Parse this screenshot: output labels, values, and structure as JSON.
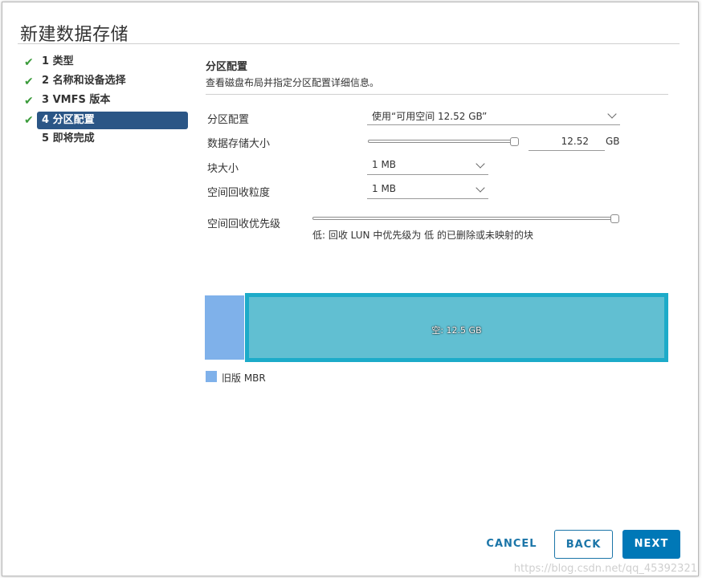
{
  "dialog": {
    "title": "新建数据存储"
  },
  "steps": [
    {
      "number": "1",
      "label": "类型",
      "done": true
    },
    {
      "number": "2",
      "label": "名称和设备选择",
      "done": true
    },
    {
      "number": "3",
      "label": "VMFS 版本",
      "done": true
    },
    {
      "number": "4",
      "label": "分区配置",
      "done": true,
      "active": true
    },
    {
      "number": "5",
      "label": "即将完成",
      "done": false
    }
  ],
  "section": {
    "title": "分区配置",
    "description": "查看磁盘布局并指定分区配置详细信息。"
  },
  "form": {
    "partition_config": {
      "label": "分区配置",
      "value": "使用“可用空间 12.52 GB”"
    },
    "datastore_size": {
      "label": "数据存储大小",
      "value": "12.52",
      "unit": "GB",
      "slider_level": 1.0
    },
    "block_size": {
      "label": "块大小",
      "value": "1 MB"
    },
    "reclaim_granularity": {
      "label": "空间回收粒度",
      "value": "1 MB"
    },
    "reclaim_priority": {
      "label": "空间回收优先级",
      "slider_level": 1.0,
      "hint": "低: 回收 LUN 中优先级为 低 的已删除或未映射的块"
    }
  },
  "layout_bar": {
    "free_label": "空: 12.5 GB",
    "legacy_color": "#7fb1ea",
    "free_color": "#61bfd2",
    "free_border_color": "#1cabc9"
  },
  "legend": {
    "label": "旧版 MBR",
    "color": "#7fb1ea"
  },
  "buttons": {
    "cancel": "CANCEL",
    "back": "BACK",
    "next": "NEXT"
  },
  "watermark": "https://blog.csdn.net/qq_45392321",
  "colors": {
    "accent": "#0078b7",
    "active_step": "#2b5686",
    "check": "#3a9b3a"
  },
  "icons": {
    "check": "check-icon",
    "dropdown": "chevron-down-icon"
  }
}
